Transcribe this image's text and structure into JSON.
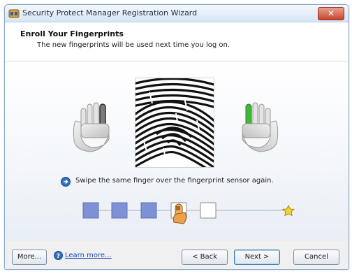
{
  "window": {
    "title": "Security Protect Manager Registration Wizard",
    "close_glyph": "✕"
  },
  "header": {
    "title": "Enroll Your Fingerprints",
    "subtitle": "The new fingerprints will be used next time you log on."
  },
  "enrollment": {
    "left_hand_icon": "left-hand-icon",
    "right_hand_icon": "right-hand-icon",
    "selected_finger_color": "#3fb83a",
    "instruction": "Swipe the same finger over the fingerprint sensor again.",
    "swipes_completed": 3,
    "swipes_total": 5,
    "current_swipe": 4,
    "completed_color": "#7e91d6"
  },
  "footer": {
    "more_label": "More...",
    "learn_more_label": "Learn more...",
    "back_label": "< Back",
    "next_label": "Next >",
    "cancel_label": "Cancel"
  }
}
